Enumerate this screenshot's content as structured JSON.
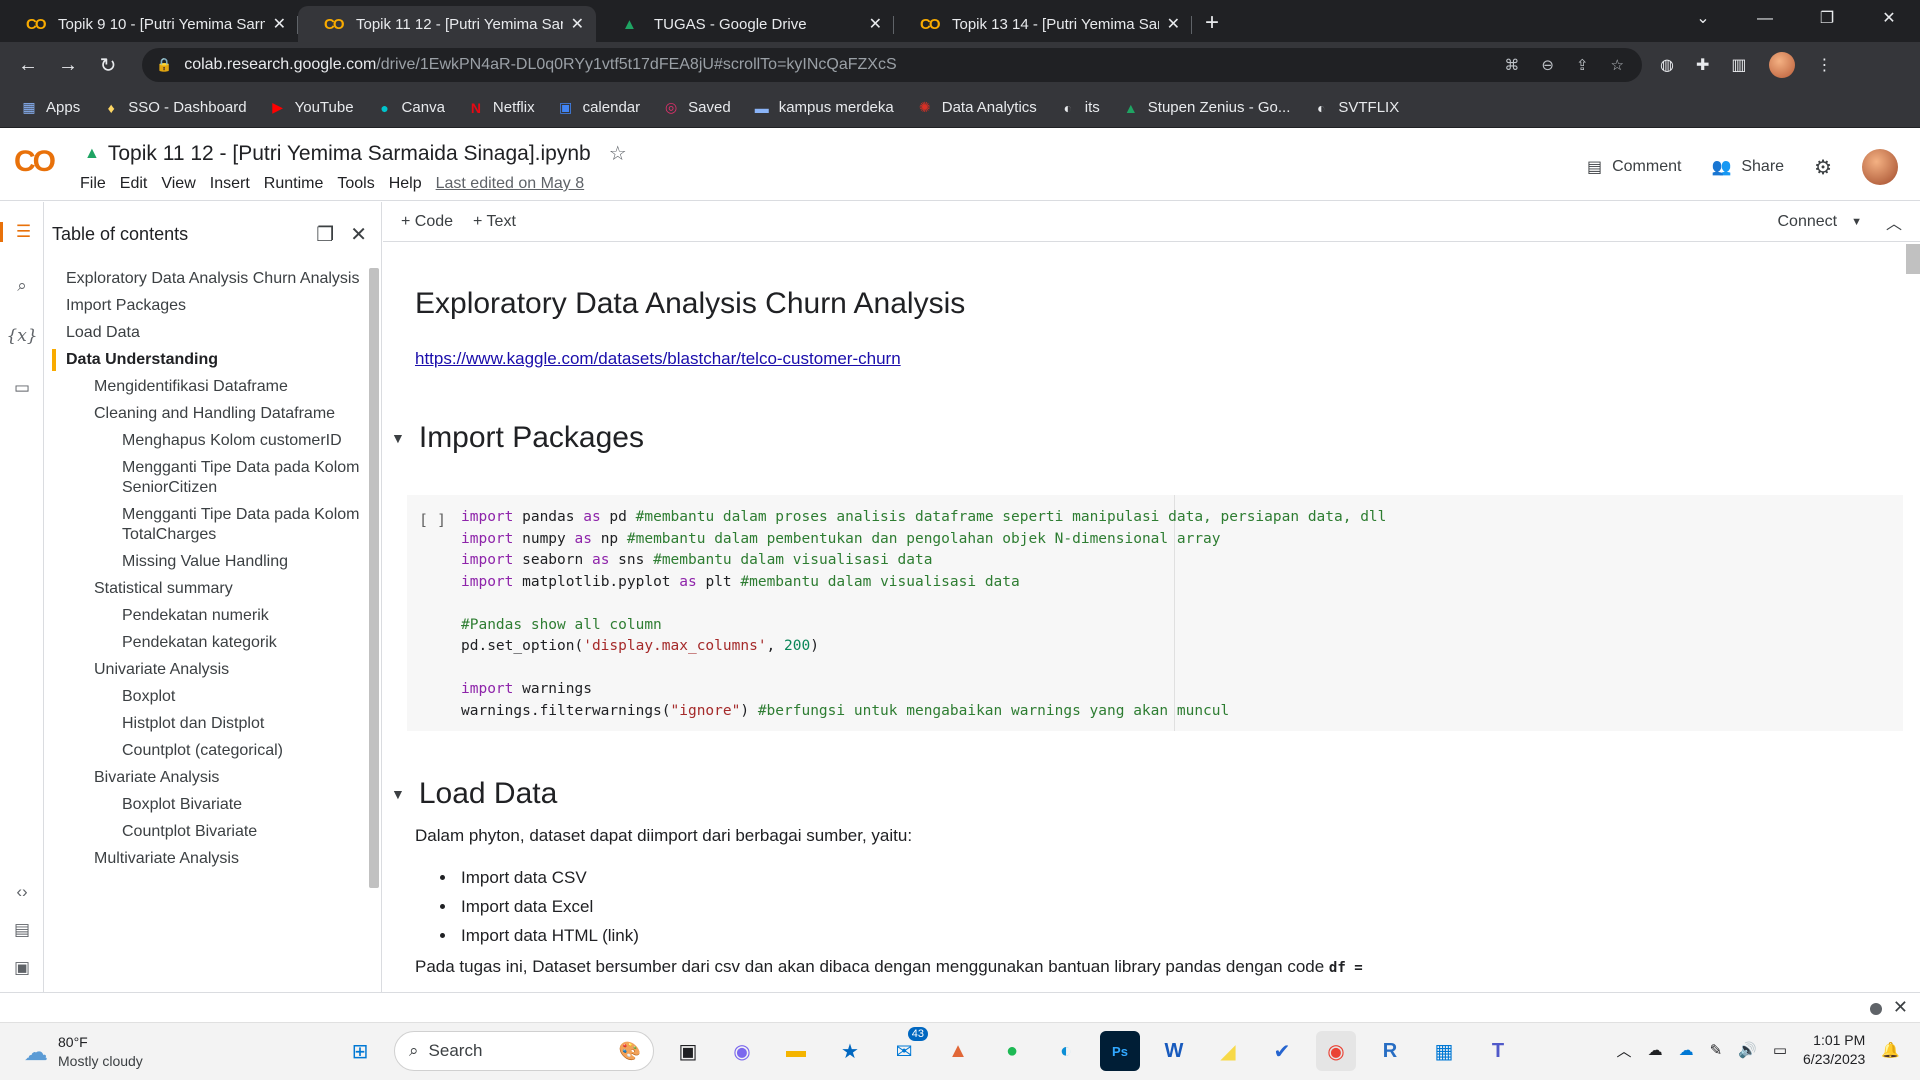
{
  "browser": {
    "tabs": [
      {
        "title": "Topik 9 10 - [Putri Yemima Sarmaida Sinaga]",
        "icon": "colab-icon",
        "active": false
      },
      {
        "title": "Topik 11 12 - [Putri Yemima Sarmaida Sinaga]",
        "icon": "colab-icon",
        "active": true
      },
      {
        "title": "TUGAS - Google Drive",
        "icon": "drive-icon",
        "active": false
      },
      {
        "title": "Topik 13 14 - [Putri Yemima Sarmaida Sinaga]",
        "icon": "colab-icon",
        "active": false
      }
    ],
    "url_host": "colab.research.google.com",
    "url_path": "/drive/1EwkPN4aR-DL0q0RYy1vtf5t17dFEA8jU#scrollTo=kyINcQaFZXcS",
    "bookmarks": [
      "Apps",
      "SSO - Dashboard",
      "YouTube",
      "Canva",
      "Netflix",
      "calendar",
      "Saved",
      "kampus merdeka",
      "Data Analytics",
      "its",
      "Stupen Zenius - Go...",
      "SVTFLIX"
    ]
  },
  "colab": {
    "logo": "CO",
    "notebook_title": "Topik 11 12 - [Putri Yemima Sarmaida Sinaga].ipynb",
    "menu": [
      "File",
      "Edit",
      "View",
      "Insert",
      "Runtime",
      "Tools",
      "Help"
    ],
    "last_edited": "Last edited on May 8",
    "comment_label": "Comment",
    "share_label": "Share",
    "add_code": "+ Code",
    "add_text": "+ Text",
    "connect_label": "Connect"
  },
  "toc": {
    "title": "Table of contents",
    "items": [
      {
        "label": "Exploratory Data Analysis Churn Analysis",
        "level": 1
      },
      {
        "label": "Import Packages",
        "level": 1
      },
      {
        "label": "Load Data",
        "level": 1
      },
      {
        "label": "Data Understanding",
        "level": 1,
        "selected": true
      },
      {
        "label": "Mengidentifikasi Dataframe",
        "level": 2
      },
      {
        "label": "Cleaning and Handling Dataframe",
        "level": 2
      },
      {
        "label": "Menghapus Kolom customerID",
        "level": 3
      },
      {
        "label": "Mengganti Tipe Data pada Kolom SeniorCitizen",
        "level": 3
      },
      {
        "label": "Mengganti Tipe Data pada Kolom TotalCharges",
        "level": 3
      },
      {
        "label": "Missing Value Handling",
        "level": 3
      },
      {
        "label": "Statistical summary",
        "level": 2
      },
      {
        "label": "Pendekatan numerik",
        "level": 3
      },
      {
        "label": "Pendekatan kategorik",
        "level": 3
      },
      {
        "label": "Univariate Analysis",
        "level": 2
      },
      {
        "label": "Boxplot",
        "level": 3
      },
      {
        "label": "Histplot dan Distplot",
        "level": 3
      },
      {
        "label": "Countplot (categorical)",
        "level": 3
      },
      {
        "label": "Bivariate Analysis",
        "level": 2
      },
      {
        "label": "Boxplot Bivariate",
        "level": 3
      },
      {
        "label": "Countplot Bivariate",
        "level": 3
      },
      {
        "label": "Multivariate Analysis",
        "level": 2
      }
    ]
  },
  "notebook": {
    "heading": "Exploratory Data Analysis Churn Analysis",
    "link": "https://www.kaggle.com/datasets/blastchar/telco-customer-churn",
    "section_import": "Import Packages",
    "run_indicator": "[ ]",
    "code": [
      {
        "kw": "import",
        "mid": " pandas ",
        "kw2": "as",
        "tail": " pd ",
        "cm": "#membantu dalam proses analisis dataframe seperti manipulasi data, persiapan data, dll"
      },
      {
        "kw": "import",
        "mid": " numpy ",
        "kw2": "as",
        "tail": " np ",
        "cm": "#membantu dalam pembentukan dan pengolahan objek N-dimensional array"
      },
      {
        "kw": "import",
        "mid": " seaborn ",
        "kw2": "as",
        "tail": " sns ",
        "cm": "#membantu dalam visualisasi data"
      },
      {
        "kw": "import",
        "mid": " matplotlib.pyplot ",
        "kw2": "as",
        "tail": " plt ",
        "cm": "#membantu dalam visualisasi data"
      }
    ],
    "code_comment2": "#Pandas show all column",
    "code_setoption_pre": "pd.set_option(",
    "code_setoption_str": "'display.max_columns'",
    "code_setoption_sep": ", ",
    "code_setoption_num": "200",
    "code_setoption_post": ")",
    "code_import_warnings_kw": "import",
    "code_import_warnings_rest": " warnings",
    "code_filter_pre": "warnings.filterwarnings(",
    "code_filter_str": "\"ignore\"",
    "code_filter_post": ") ",
    "code_filter_cm": "#berfungsi untuk mengabaikan warnings yang akan muncul",
    "section_load": "Load Data",
    "load_intro": "Dalam phyton, dataset dapat diimport dari berbagai sumber, yaitu:",
    "load_list": [
      "Import data CSV",
      "Import data Excel",
      "Import data HTML (link)"
    ],
    "load_note": "Pada tugas ini, Dataset bersumber dari csv dan akan dibaca dengan menggunakan bantuan library pandas dengan code",
    "load_note_code": "df ="
  },
  "taskbar": {
    "temp": "80°F",
    "weather": "Mostly cloudy",
    "search_placeholder": "Search",
    "mail_badge": "43",
    "time": "1:01 PM",
    "date": "6/23/2023"
  }
}
